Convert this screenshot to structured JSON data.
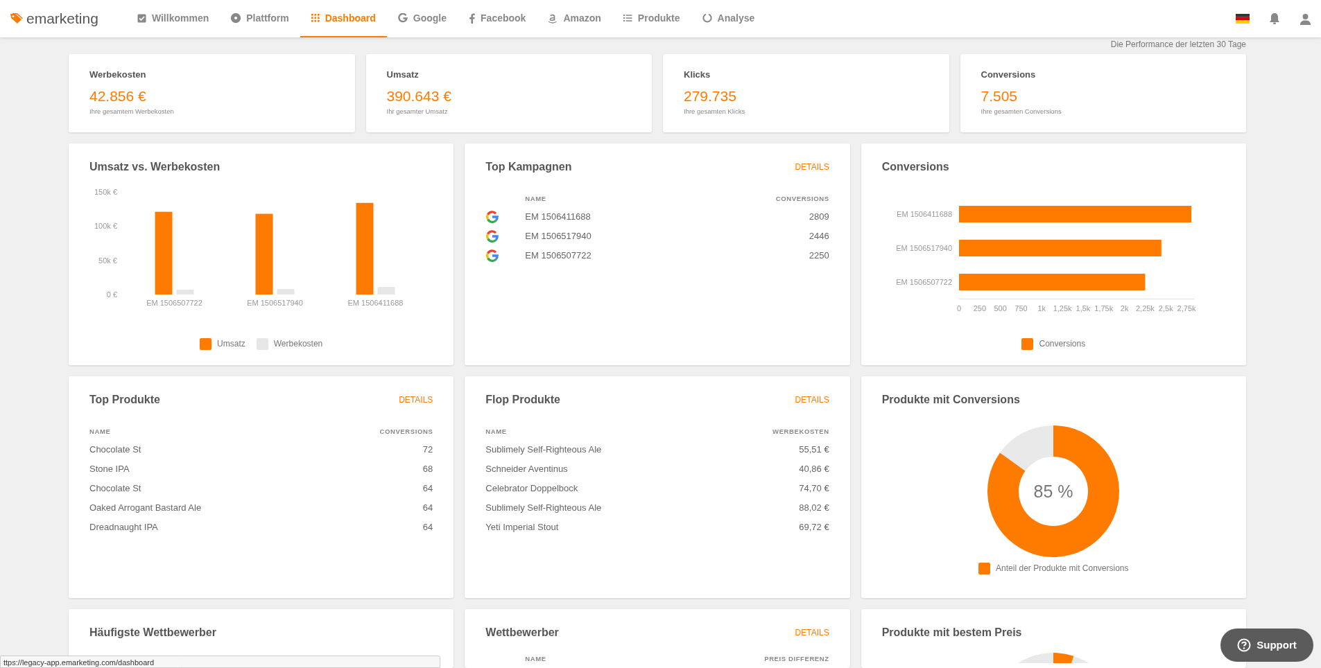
{
  "navbar": {
    "brand": "emarketing",
    "items": [
      {
        "label": "Willkommen",
        "selected": false
      },
      {
        "label": "Plattform",
        "selected": false
      },
      {
        "label": "Dashboard",
        "selected": true
      },
      {
        "label": "Google",
        "selected": false
      },
      {
        "label": "Facebook",
        "selected": false
      },
      {
        "label": "Amazon",
        "selected": false
      },
      {
        "label": "Produkte",
        "selected": false
      },
      {
        "label": "Analyse",
        "selected": false
      }
    ]
  },
  "subtitle": "Die Performance der letzten 30 Tage",
  "kpis": [
    {
      "title": "Werbekosten",
      "value": "42.856 €",
      "caption": "Ihre gesamtem Werbekosten"
    },
    {
      "title": "Umsatz",
      "value": "390.643 €",
      "caption": "Ihr gesamter Umsatz"
    },
    {
      "title": "Klicks",
      "value": "279.735",
      "caption": "Ihre gesamten Klicks"
    },
    {
      "title": "Conversions",
      "value": "7.505",
      "caption": "Ihre gesamten Conversions"
    }
  ],
  "revenue_vs_cost": {
    "title": "Umsatz vs. Werbekosten",
    "chart_data": {
      "type": "bar",
      "categories": [
        "EM 1506507722",
        "EM 1506517940",
        "EM 1506411688"
      ],
      "series": [
        {
          "name": "Umsatz",
          "color": "#ff7b00",
          "values": [
            121000,
            118000,
            134000
          ]
        },
        {
          "name": "Werbekosten",
          "color": "#e6e6e6",
          "values": [
            7000,
            8000,
            11000
          ]
        }
      ],
      "ylim": [
        0,
        150000
      ],
      "yticks": [
        {
          "value": 0,
          "label": "0 €"
        },
        {
          "value": 50000,
          "label": "50k €"
        },
        {
          "value": 100000,
          "label": "100k €"
        },
        {
          "value": 150000,
          "label": "150k €"
        }
      ]
    }
  },
  "top_campaigns": {
    "title": "Top Kampagnen",
    "link": "DETAILS",
    "columns": [
      "NAME",
      "CONVERSIONS"
    ],
    "rows": [
      {
        "name": "EM 1506411688",
        "value": "2809"
      },
      {
        "name": "EM 1506517940",
        "value": "2446"
      },
      {
        "name": "EM 1506507722",
        "value": "2250"
      }
    ]
  },
  "conversions": {
    "title": "Conversions",
    "chart_data": {
      "type": "bar",
      "orientation": "horizontal",
      "categories": [
        "EM 1506411688",
        "EM 1506517940",
        "EM 1506507722"
      ],
      "series": [
        {
          "name": "Conversions",
          "color": "#ff7b00",
          "values": [
            2809,
            2446,
            2250
          ]
        }
      ],
      "xlim": [
        0,
        2850
      ],
      "xticks": [
        {
          "value": 0,
          "label": "0"
        },
        {
          "value": 250,
          "label": "250"
        },
        {
          "value": 500,
          "label": "500"
        },
        {
          "value": 750,
          "label": "750"
        },
        {
          "value": 1000,
          "label": "1k"
        },
        {
          "value": 1250,
          "label": "1,25k"
        },
        {
          "value": 1500,
          "label": "1,5k"
        },
        {
          "value": 1750,
          "label": "1,75k"
        },
        {
          "value": 2000,
          "label": "2k"
        },
        {
          "value": 2250,
          "label": "2,25k"
        },
        {
          "value": 2500,
          "label": "2,5k"
        },
        {
          "value": 2750,
          "label": "2,75k"
        }
      ]
    }
  },
  "top_products": {
    "title": "Top Produkte",
    "link": "DETAILS",
    "columns": [
      "NAME",
      "CONVERSIONS"
    ],
    "rows": [
      {
        "name": "Chocolate St",
        "value": "72"
      },
      {
        "name": "Stone IPA",
        "value": "68"
      },
      {
        "name": "Chocolate St",
        "value": "64"
      },
      {
        "name": "Oaked Arrogant Bastard Ale",
        "value": "64"
      },
      {
        "name": "Dreadnaught IPA",
        "value": "64"
      }
    ]
  },
  "flop_products": {
    "title": "Flop Produkte",
    "link": "DETAILS",
    "columns": [
      "NAME",
      "WERBEKOSTEN"
    ],
    "rows": [
      {
        "name": "Sublimely Self-Righteous Ale",
        "value": "55,51 €"
      },
      {
        "name": "Schneider Aventinus",
        "value": "40,86 €"
      },
      {
        "name": "Celebrator Doppelbock",
        "value": "74,70 €"
      },
      {
        "name": "Sublimely Self-Righteous Ale",
        "value": "88,02 €"
      },
      {
        "name": "Yeti Imperial Stout",
        "value": "69,72 €"
      }
    ]
  },
  "products_with_conversions": {
    "title": "Produkte mit Conversions",
    "center_label": "85 %",
    "chart_data": {
      "type": "donut",
      "categories": [
        "Anteil der Produkte mit Conversions",
        null
      ],
      "values": [
        85,
        15
      ]
    }
  },
  "frequent_competitors": {
    "title": "Häufigste Wettbewerber"
  },
  "competitors": {
    "title": "Wettbewerber",
    "link": "DETAILS",
    "columns": [
      "NAME",
      "PREIS DIFFERENZ"
    ]
  },
  "best_price_products": {
    "title": "Produkte mit bestem Preis"
  },
  "status_bar": {
    "url": "ttps://legacy-app.emarketing.com/dashboard"
  },
  "support_button": {
    "label": "Support"
  }
}
